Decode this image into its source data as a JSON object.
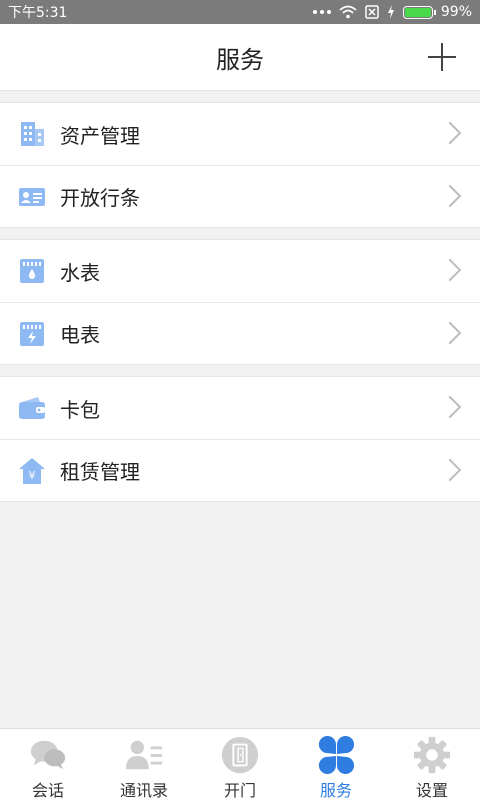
{
  "status_bar": {
    "time": "下午5:31",
    "battery_percent": "99%",
    "battery_level": 0.99
  },
  "header": {
    "title": "服务",
    "add_icon": "plus-icon"
  },
  "groups": [
    {
      "items": [
        {
          "label": "资产管理",
          "icon": "building-icon",
          "color": "#8fb9f2"
        },
        {
          "label": "开放行条",
          "icon": "id-card-icon",
          "color": "#8fb9f2"
        }
      ]
    },
    {
      "items": [
        {
          "label": "水表",
          "icon": "water-meter-icon",
          "color": "#8fb9f2"
        },
        {
          "label": "电表",
          "icon": "electric-meter-icon",
          "color": "#8fb9f2"
        }
      ]
    },
    {
      "items": [
        {
          "label": "卡包",
          "icon": "wallet-icon",
          "color": "#8fb9f2"
        },
        {
          "label": "租赁管理",
          "icon": "rent-house-icon",
          "color": "#8fb9f2"
        }
      ]
    }
  ],
  "tabs": [
    {
      "label": "会话",
      "icon": "chat-icon",
      "active": false
    },
    {
      "label": "通讯录",
      "icon": "contacts-icon",
      "active": false
    },
    {
      "label": "开门",
      "icon": "door-icon",
      "active": false
    },
    {
      "label": "服务",
      "icon": "clover-icon",
      "active": true
    },
    {
      "label": "设置",
      "icon": "gear-icon",
      "active": false
    }
  ],
  "colors": {
    "accent": "#2f7de1",
    "inactive_icon": "#c8c8c8",
    "list_icon": "#8fb9f2"
  }
}
